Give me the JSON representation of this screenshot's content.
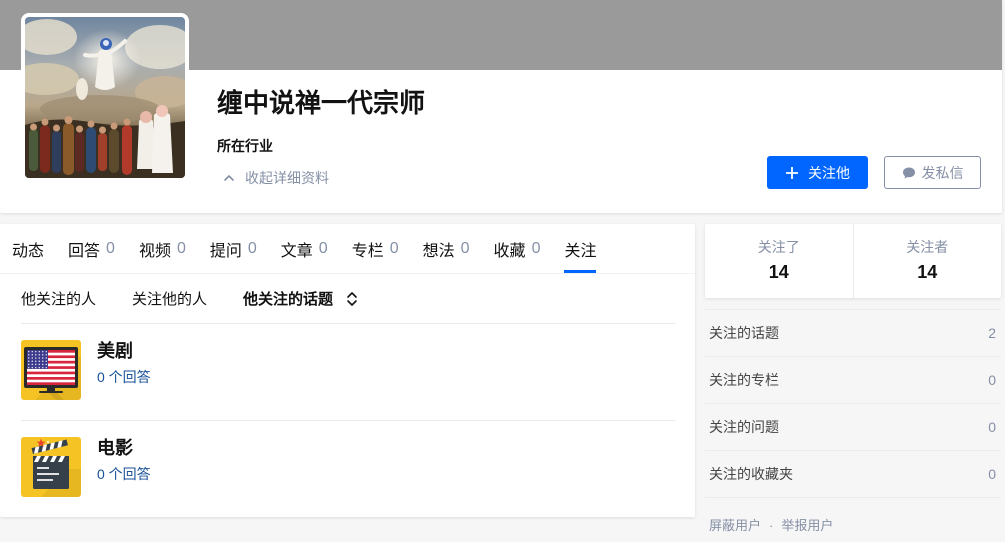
{
  "profile": {
    "name": "缠中说禅一代宗师",
    "industry_label": "所在行业",
    "collapse_label": "收起详细资料",
    "follow_label": "关注他",
    "message_label": "发私信",
    "icons": {
      "collapse": "chevron-up-icon",
      "follow": "plus-icon",
      "message": "chat-bubble-icon"
    }
  },
  "tabs": [
    {
      "label": "动态"
    },
    {
      "label": "回答",
      "count": "0"
    },
    {
      "label": "视频",
      "count": "0"
    },
    {
      "label": "提问",
      "count": "0"
    },
    {
      "label": "文章",
      "count": "0"
    },
    {
      "label": "专栏",
      "count": "0"
    },
    {
      "label": "想法",
      "count": "0"
    },
    {
      "label": "收藏",
      "count": "0"
    },
    {
      "label": "关注",
      "active": true
    }
  ],
  "subnav": {
    "items": [
      {
        "label": "他关注的人"
      },
      {
        "label": "关注他的人"
      },
      {
        "label": "他关注的话题",
        "active": true
      }
    ],
    "sort_icon": "sort-icon"
  },
  "topics": [
    {
      "name": "美剧",
      "answers": "0 个回答",
      "icon": "us-flag-tv-icon"
    },
    {
      "name": "电影",
      "answers": "0 个回答",
      "icon": "clapperboard-icon"
    }
  ],
  "follow_stats": [
    {
      "label": "关注了",
      "value": "14"
    },
    {
      "label": "关注者",
      "value": "14"
    }
  ],
  "sidebar_links": [
    {
      "label": "关注的话题",
      "count": "2"
    },
    {
      "label": "关注的专栏",
      "count": "0"
    },
    {
      "label": "关注的问题",
      "count": "0"
    },
    {
      "label": "关注的收藏夹",
      "count": "0"
    }
  ],
  "footer": {
    "block_label": "屏蔽用户",
    "separator": "·",
    "report_label": "举报用户"
  },
  "colors": {
    "accent": "#0066ff",
    "link": "#175199",
    "muted": "#8590a6",
    "cover": "#9a9a9a",
    "topic_icon_bg": "#f5c324",
    "page_bg": "#f6f6f6"
  }
}
